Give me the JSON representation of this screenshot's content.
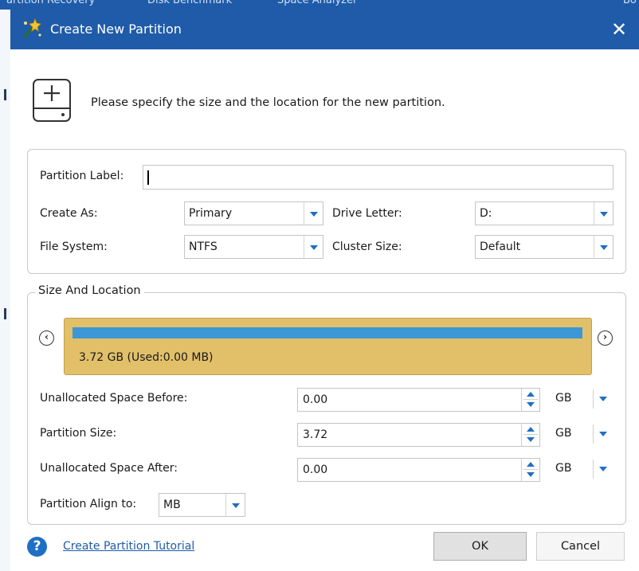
{
  "background_app": {
    "tabs": [
      "artition Recovery",
      "Disk Benchmark",
      "Space Analyzer",
      "Bo"
    ]
  },
  "dialog": {
    "title": "Create New Partition",
    "close_symbol": "✕",
    "header_icon": "add-disk-icon",
    "header_text": "Please specify the size and the location for the new partition."
  },
  "partition_settings": {
    "label_caption": "Partition Label:",
    "label_value": "",
    "create_as_caption": "Create As:",
    "create_as_value": "Primary",
    "drive_letter_caption": "Drive Letter:",
    "drive_letter_value": "D:",
    "file_system_caption": "File System:",
    "file_system_value": "NTFS",
    "cluster_size_caption": "Cluster Size:",
    "cluster_size_value": "Default"
  },
  "size_location": {
    "legend": "Size And Location",
    "nav_left": "‹",
    "nav_right": "›",
    "partition_text": "3.72 GB (Used:0.00 MB)",
    "before_caption": "Unallocated Space Before:",
    "before_value": "0.00",
    "before_unit": "GB",
    "size_caption": "Partition Size:",
    "size_value": "3.72",
    "size_unit": "GB",
    "after_caption": "Unallocated Space After:",
    "after_value": "0.00",
    "after_unit": "GB",
    "align_caption": "Partition Align to:",
    "align_value": "MB"
  },
  "footer": {
    "help_symbol": "?",
    "tutorial_link": "Create Partition Tutorial",
    "ok_label": "OK",
    "cancel_label": "Cancel"
  },
  "colors": {
    "titlebar": "#1f5ba8",
    "partition_block": "#e2c06a",
    "partition_fill": "#3d97d6",
    "accent": "#1f6fc4"
  }
}
